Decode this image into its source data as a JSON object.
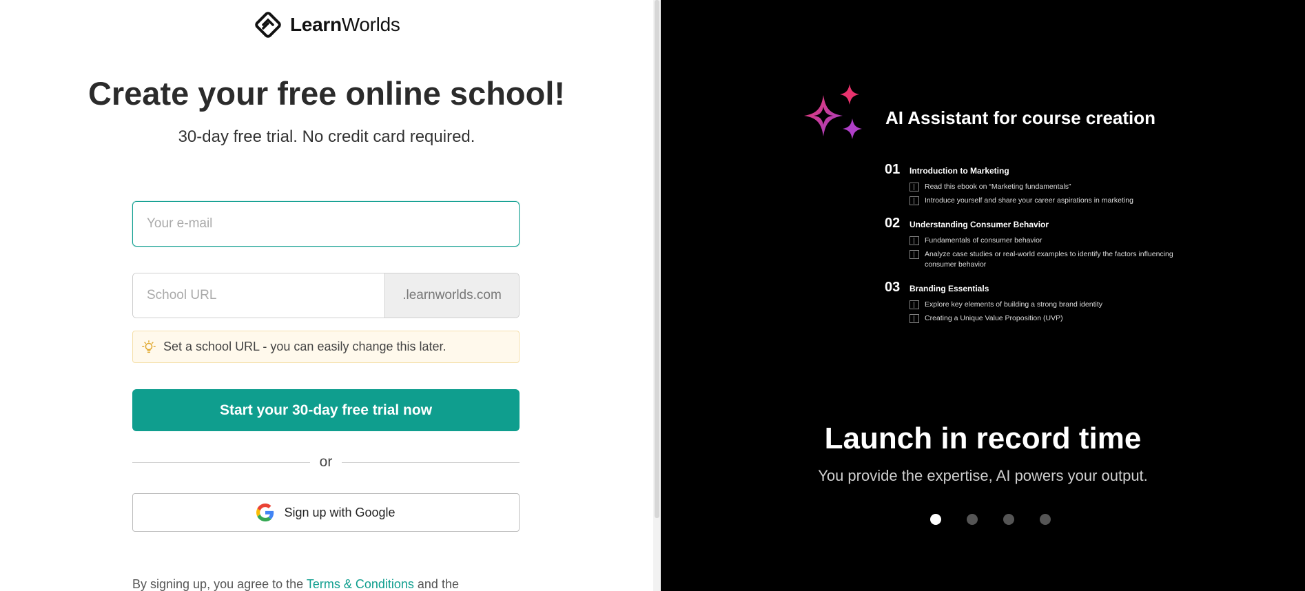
{
  "logo": {
    "bold": "Learn",
    "regular": "Worlds"
  },
  "signup": {
    "title": "Create your free online school!",
    "subtitle": "30-day free trial. No credit card required.",
    "email_placeholder": "Your e-mail",
    "url_placeholder": "School URL",
    "url_suffix": ".learnworlds.com",
    "hint": "Set a school URL - you can easily change this later.",
    "cta_label": "Start your 30-day free trial now",
    "or_label": "or",
    "google_label": "Sign up with Google",
    "terms_prefix": "By signing up, you agree to the ",
    "terms_link": "Terms & Conditions",
    "terms_suffix": " and the"
  },
  "promo": {
    "ai_title": "AI Assistant for course creation",
    "modules": [
      {
        "num": "01",
        "title": "Introduction to Marketing",
        "lessons": [
          "Read this ebook on “Marketing fundamentals”",
          "Introduce yourself and share your career aspirations in marketing"
        ]
      },
      {
        "num": "02",
        "title": "Understanding Consumer Behavior",
        "lessons": [
          "Fundamentals of consumer behavior",
          "Analyze case studies or real-world examples to identify the factors influencing consumer behavior"
        ]
      },
      {
        "num": "03",
        "title": "Branding Essentials",
        "lessons": [
          "Explore key elements of building a strong brand identity",
          "Creating a Unique Value Proposition (UVP)"
        ]
      }
    ],
    "slide_title": "Launch in record time",
    "slide_subtitle": "You provide the expertise, AI powers your output.",
    "carousel_active": 1,
    "carousel_count": 4
  },
  "colors": {
    "brand_teal": "#0f9e8e",
    "hint_bg": "#fff9ec",
    "sparkle_pink": "#e8336d",
    "sparkle_purple": "#9b3fd1"
  },
  "icons": [
    "learnworlds-logo-icon",
    "lightbulb-icon",
    "google-icon",
    "sparkles-icon",
    "book-icon"
  ]
}
